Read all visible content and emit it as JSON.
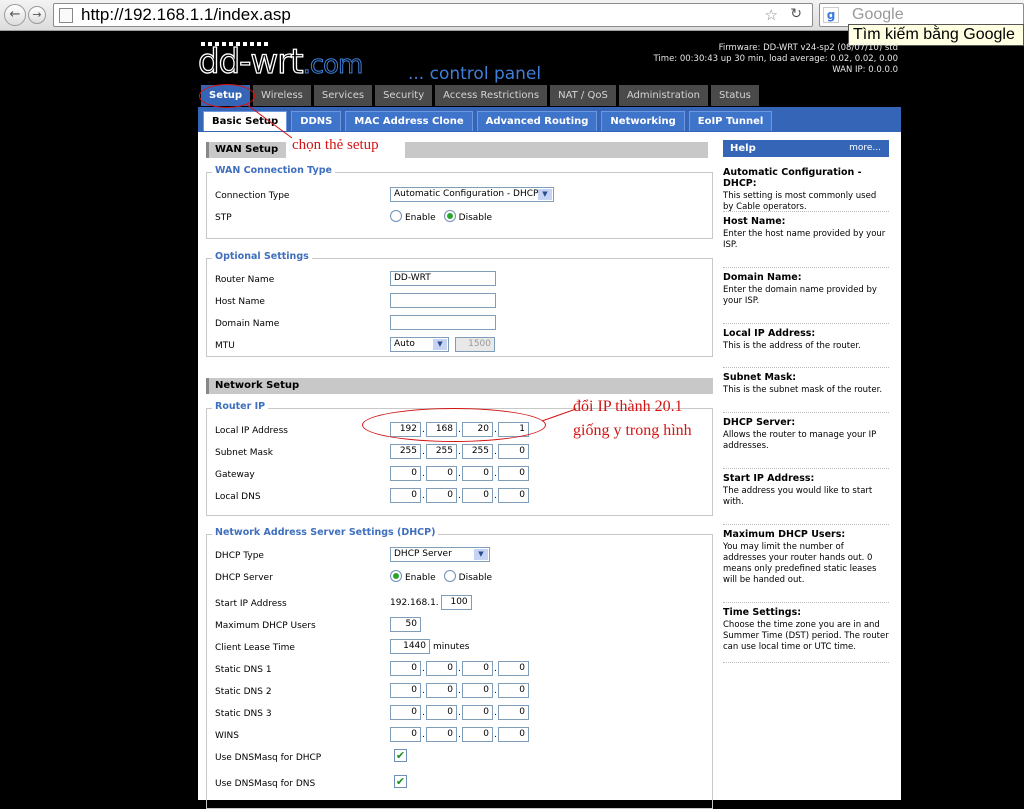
{
  "browser": {
    "back_icon": "back-arrow-icon",
    "forward_icon": "forward-arrow-icon",
    "url": "http://192.168.1.1/index.asp",
    "search_placeholder": "Google",
    "tooltip": "Tìm kiếm bằng Google"
  },
  "header": {
    "logo": "dd-wrt",
    "logo_suffix": ".com",
    "control_panel": "... control panel",
    "firmware": "Firmware: DD-WRT v24-sp2 (08/07/10) std",
    "time": "Time: 00:30:43 up 30 min, load average: 0.02, 0.02, 0.00",
    "wan_ip": "WAN IP: 0.0.0.0"
  },
  "main_tabs": [
    "Setup",
    "Wireless",
    "Services",
    "Security",
    "Access Restrictions",
    "NAT / QoS",
    "Administration",
    "Status"
  ],
  "sub_tabs": [
    "Basic Setup",
    "DDNS",
    "MAC Address Clone",
    "Advanced Routing",
    "Networking",
    "EoIP Tunnel"
  ],
  "wan": {
    "title": "WAN Setup",
    "conn_legend": "WAN Connection Type",
    "conn_type_label": "Connection Type",
    "conn_type_value": "Automatic Configuration - DHCP",
    "stp_label": "STP",
    "enable": "Enable",
    "disable": "Disable"
  },
  "optional": {
    "legend": "Optional Settings",
    "router_name_label": "Router Name",
    "router_name_value": "DD-WRT",
    "host_name_label": "Host Name",
    "host_name_value": "",
    "domain_name_label": "Domain Name",
    "domain_name_value": "",
    "mtu_label": "MTU",
    "mtu_mode": "Auto",
    "mtu_value": "1500"
  },
  "network": {
    "title": "Network Setup",
    "router_ip_legend": "Router IP",
    "local_ip_label": "Local IP Address",
    "local_ip": [
      "192",
      "168",
      "20",
      "1"
    ],
    "subnet_label": "Subnet Mask",
    "subnet": [
      "255",
      "255",
      "255",
      "0"
    ],
    "gateway_label": "Gateway",
    "gateway": [
      "0",
      "0",
      "0",
      "0"
    ],
    "local_dns_label": "Local DNS",
    "local_dns": [
      "0",
      "0",
      "0",
      "0"
    ]
  },
  "dhcp": {
    "legend": "Network Address Server Settings (DHCP)",
    "type_label": "DHCP Type",
    "type_value": "DHCP Server",
    "server_label": "DHCP Server",
    "enable": "Enable",
    "disable": "Disable",
    "start_ip_label": "Start IP Address",
    "start_ip_prefix": "192.168.1.",
    "start_ip_value": "100",
    "max_users_label": "Maximum DHCP Users",
    "max_users_value": "50",
    "lease_label": "Client Lease Time",
    "lease_value": "1440",
    "lease_unit": "minutes",
    "dns1_label": "Static DNS 1",
    "dns1": [
      "0",
      "0",
      "0",
      "0"
    ],
    "dns2_label": "Static DNS 2",
    "dns2": [
      "0",
      "0",
      "0",
      "0"
    ],
    "dns3_label": "Static DNS 3",
    "dns3": [
      "0",
      "0",
      "0",
      "0"
    ],
    "wins_label": "WINS",
    "wins": [
      "0",
      "0",
      "0",
      "0"
    ],
    "dnsmasq_dhcp_label": "Use DNSMasq for DHCP",
    "dnsmasq_dns_label": "Use DNSMasq for DNS",
    "check_mark": "✔"
  },
  "help": {
    "title": "Help",
    "more": "more...",
    "items": [
      {
        "title": "Automatic Configuration - DHCP:",
        "text": "This setting is most commonly used by Cable operators."
      },
      {
        "title": "Host Name:",
        "text": "Enter the host name provided by your ISP."
      },
      {
        "title": "Domain Name:",
        "text": "Enter the domain name provided by your ISP."
      },
      {
        "title": "Local IP Address:",
        "text": "This is the address of the router."
      },
      {
        "title": "Subnet Mask:",
        "text": "This is the subnet mask of the router."
      },
      {
        "title": "DHCP Server:",
        "text": "Allows the router to manage your IP addresses."
      },
      {
        "title": "Start IP Address:",
        "text": "The address you would like to start with."
      },
      {
        "title": "Maximum DHCP Users:",
        "text": "You may limit the number of addresses your router hands out. 0 means only predefined static leases will be handed out."
      },
      {
        "title": "Time Settings:",
        "text": "Choose the time zone you are in and Summer Time (DST) period. The router can use local time or UTC time."
      }
    ]
  },
  "annotations": {
    "setup_note": "chọn thẻ setup",
    "ip_note_1": "đổi IP thành 20.1",
    "ip_note_2": "giống y trong hình"
  },
  "colors": {
    "accent_blue": "#3565b7",
    "annotation_red": "#d41414",
    "dark_tab": "#4a4a4a"
  }
}
